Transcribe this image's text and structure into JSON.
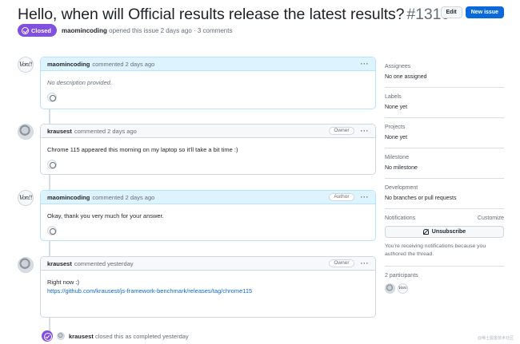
{
  "issue": {
    "title": "Hello, when will Official results release the latest results?",
    "number": "#1310",
    "state": "Closed",
    "author": "maomincoding",
    "meta_text": "opened this issue 2 days ago · 3 comments"
  },
  "header_buttons": {
    "edit": "Edit",
    "new_issue": "New issue"
  },
  "comments": [
    {
      "author": "maomincoding",
      "time": "commented 2 days ago",
      "role": "",
      "body": "No description provided.",
      "link": ""
    },
    {
      "author": "krausest",
      "time": "commented 2 days ago",
      "role": "Owner",
      "body": "Chrome 115 appeared this morning on my laptop so it'll take a bit time :)",
      "link": ""
    },
    {
      "author": "maomincoding",
      "time": "commented 2 days ago",
      "role": "Author",
      "body": "Okay, thank you very much for your answer.",
      "link": ""
    },
    {
      "author": "krausest",
      "time": "commented yesterday",
      "role": "Owner",
      "body": "Right now :)",
      "link": "https://github.com/krausest/js-framework-benchmark/releases/tag/chrome115"
    }
  ],
  "comment_menu": "···",
  "event": {
    "actor": "krausest",
    "text": "closed this as completed yesterday"
  },
  "sidebar": {
    "assignees": {
      "label": "Assignees",
      "value": "No one assigned"
    },
    "labels": {
      "label": "Labels",
      "value": "None yet"
    },
    "projects": {
      "label": "Projects",
      "value": "None yet"
    },
    "milestone": {
      "label": "Milestone",
      "value": "No milestone"
    },
    "development": {
      "label": "Development",
      "value": "No branches or pull requests"
    },
    "notifications": {
      "label": "Notifications",
      "customize": "Customize",
      "button": "Unsubscribe",
      "note": "You're receiving notifications because you authored the thread."
    },
    "participants": {
      "label": "2 participants"
    }
  },
  "avatar_text": "Von!!",
  "watermark": "@稀土掘金技术社区",
  "colors": {
    "closed": "#8250df",
    "primary": "#0969da",
    "author_highlight": "#ddf4ff"
  },
  "icons": [
    "closed-state-icon",
    "kebab-menu-icon",
    "smiley-icon",
    "bell-slash-icon"
  ]
}
